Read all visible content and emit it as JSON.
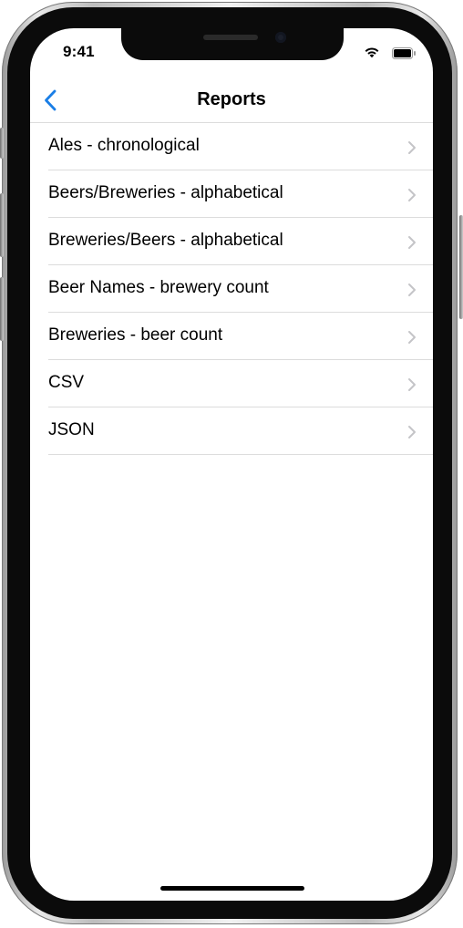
{
  "status_bar": {
    "time": "9:41",
    "icons": [
      "wifi-icon",
      "battery-icon"
    ]
  },
  "nav": {
    "title": "Reports",
    "back_icon": "chevron-left-icon",
    "accent_color": "#1a7ee6"
  },
  "reports": [
    {
      "label": "Ales - chronological"
    },
    {
      "label": "Beers/Breweries - alphabetical"
    },
    {
      "label": "Breweries/Beers - alphabetical"
    },
    {
      "label": "Beer Names - brewery count"
    },
    {
      "label": "Breweries - beer count"
    },
    {
      "label": "CSV"
    },
    {
      "label": "JSON"
    }
  ],
  "row_icon": "chevron-right-icon"
}
